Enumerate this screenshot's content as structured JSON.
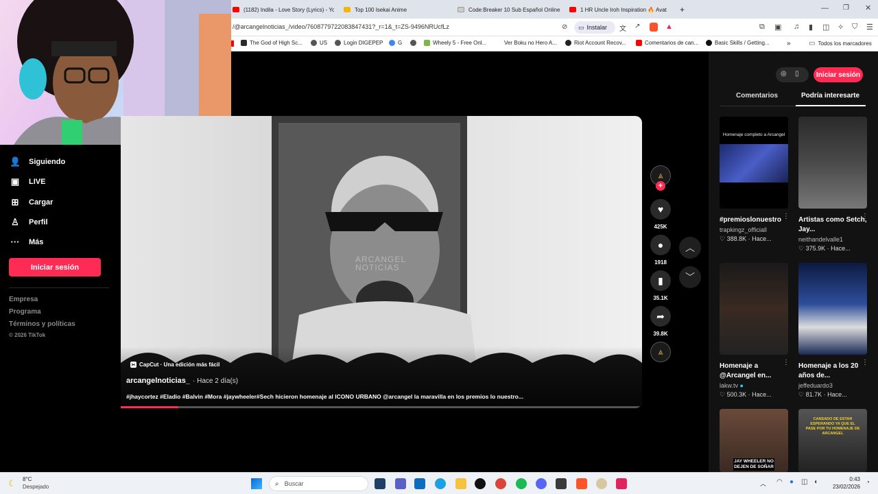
{
  "browser": {
    "tabs": [
      {
        "label": "(1182) Indila - Love Story (Lyrics) - Yo",
        "color": "#ff0000"
      },
      {
        "label": "Top 100 Isekai Anime",
        "color": "#f2b705"
      },
      {
        "label": "Code:Breaker 10 Sub Español Online",
        "color": "#e8e8e8"
      },
      {
        "label": "1 HR Uncle Iroh Inspiration 🔥 Avat",
        "color": "#ff0000"
      }
    ],
    "new_tab": "+",
    "url": "/@arcangelnoticias_/video/7608779722083847431?_r=1&_t=ZS-9496NRUcfLz",
    "install_label": "Instalar",
    "bookmarks": [
      "The God of High Sc...",
      "US",
      "Login DIGEPEP",
      "G",
      "Wheely 5 - Free Onl...",
      "Ver Boku no Hero A...",
      "Riot Account Recov...",
      "Comentarios de can...",
      "Basic Skills / Getting..."
    ],
    "bookmarks_more": "»",
    "all_bookmarks": "Todos los marcadores"
  },
  "nav": {
    "items": [
      {
        "label": "Siguiendo",
        "icon": "following-icon"
      },
      {
        "label": "LIVE",
        "icon": "live-icon"
      },
      {
        "label": "Cargar",
        "icon": "upload-icon"
      },
      {
        "label": "Perfil",
        "icon": "profile-icon"
      },
      {
        "label": "Más",
        "icon": "more-icon"
      }
    ],
    "login": "Iniciar sesión",
    "footer": [
      "Empresa",
      "Programa",
      "Términos y políticas",
      "© 2026 TikTok"
    ]
  },
  "video": {
    "capcut": "CapCut · Una edición más fácil",
    "watermark_top": "ARCANGEL",
    "watermark_bottom": "NOTICIAS",
    "author": "arcangelnoticias_",
    "time": "· Hace 2 día(s)",
    "caption": "#jhaycortez #Eladio #Balvin #Mora #jaywheeler#Sech hicieron homenaje al ICONO URBANO @arcangel la maravilla en los premios lo nuestro...",
    "progress": 0.11
  },
  "actions": {
    "likes": "425K",
    "comments": "1918",
    "saves": "35.1K",
    "shares": "39.8K"
  },
  "sidebar": {
    "login": "Iniciar sesión",
    "tabs": [
      "Comentarios",
      "Podría interesarte"
    ],
    "cards": [
      {
        "title": "#premioslonuestro",
        "user": "trapkingz_officiall",
        "likes": "388.8K",
        "time": "Hace...",
        "thumb_text": "Homenaje completo a Arcangel"
      },
      {
        "title": "Artistas como Setch, Jay...",
        "user": "neithandelvalle1",
        "likes": "375.9K",
        "time": "Hace..."
      },
      {
        "title": "Homenaje a @Arcangel en...",
        "user": "lakw.tv",
        "likes": "500.3K",
        "time": "Hace..."
      },
      {
        "title": "Homenaje a los 20 años de...",
        "user": "jeffeduardo3",
        "likes": "81.7K",
        "time": "Hace..."
      },
      {
        "thumb_text": "JAY WHEELER NO DEJEN DE SOÑAR"
      },
      {
        "thumb_text": "CANSADO DE ESTAR ESPERANDO YA QUE EL PASE POR TU HOMENAJE DE ARCANGEL"
      }
    ]
  },
  "taskbar": {
    "weather_temp": "8°C",
    "weather_desc": "Despejado",
    "search": "Buscar",
    "time": "0:43",
    "date": "23/02/2026"
  }
}
